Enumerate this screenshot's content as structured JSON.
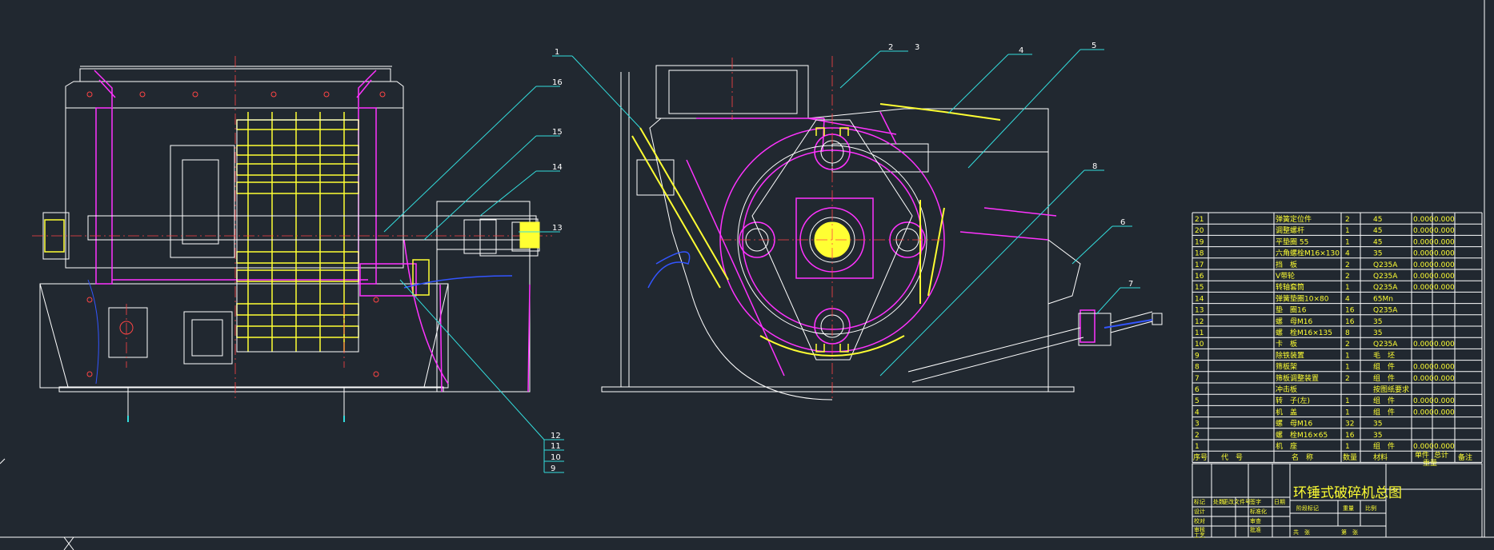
{
  "drawing": {
    "title": "环锤式破碎机总图",
    "colors": {
      "background": "#212830",
      "outline": "#ffffff",
      "magenta": "#ff33ff",
      "yellow": "#ffff33",
      "cyan": "#33dddd",
      "red": "#ff4444",
      "blue": "#3355ff",
      "green": "#88ff88"
    }
  },
  "callouts": {
    "left": [
      "16",
      "15",
      "14",
      "13",
      "12",
      "11",
      "10",
      "9"
    ],
    "right": [
      "1",
      "2",
      "3",
      "4",
      "5",
      "8",
      "6",
      "7"
    ]
  },
  "bom": {
    "header": [
      "序号",
      "代　号",
      "名　称",
      "数量",
      "材料",
      "单件",
      "总计",
      "备注"
    ],
    "weight_label": "重量",
    "rows": [
      {
        "no": "21",
        "name": "弹簧定位件",
        "qty": "2",
        "mat": "45",
        "w1": "0.000",
        "w2": "0.000"
      },
      {
        "no": "20",
        "name": "调整螺杆",
        "qty": "1",
        "mat": "45",
        "w1": "0.000",
        "w2": "0.000"
      },
      {
        "no": "19",
        "name": "平垫圈 55",
        "qty": "1",
        "mat": "45",
        "w1": "0.000",
        "w2": "0.000"
      },
      {
        "no": "18",
        "name": "六角螺栓M16×130",
        "qty": "4",
        "mat": "35",
        "w1": "0.000",
        "w2": "0.000"
      },
      {
        "no": "17",
        "name": "挡　板",
        "qty": "2",
        "mat": "Q235A",
        "w1": "0.000",
        "w2": "0.000"
      },
      {
        "no": "16",
        "name": "V带轮",
        "qty": "2",
        "mat": "Q235A",
        "w1": "0.000",
        "w2": "0.000"
      },
      {
        "no": "15",
        "name": "转轴套筒",
        "qty": "1",
        "mat": "Q235A",
        "w1": "0.000",
        "w2": "0.000"
      },
      {
        "no": "14",
        "name": "弹簧垫圈10×80",
        "qty": "4",
        "mat": "65Mn",
        "w1": "",
        "w2": ""
      },
      {
        "no": "13",
        "name": "垫　圈16",
        "qty": "16",
        "mat": "Q235A",
        "w1": "",
        "w2": ""
      },
      {
        "no": "12",
        "name": "螺　母M16",
        "qty": "16",
        "mat": "35",
        "w1": "",
        "w2": ""
      },
      {
        "no": "11",
        "name": "螺　栓M16×135",
        "qty": "8",
        "mat": "35",
        "w1": "",
        "w2": ""
      },
      {
        "no": "10",
        "name": "卡　板",
        "qty": "2",
        "mat": "Q235A",
        "w1": "0.000",
        "w2": "0.000"
      },
      {
        "no": "9",
        "name": "除铁装置",
        "qty": "1",
        "mat": "毛　坯",
        "w1": "",
        "w2": ""
      },
      {
        "no": "8",
        "name": "筛板架",
        "qty": "1",
        "mat": "组　件",
        "w1": "0.000",
        "w2": "0.000"
      },
      {
        "no": "7",
        "name": "筛板调整装置",
        "qty": "2",
        "mat": "组　件",
        "w1": "0.000",
        "w2": "0.000"
      },
      {
        "no": "6",
        "name": "冲击板",
        "qty": "",
        "mat": "按图纸要求",
        "w1": "",
        "w2": ""
      },
      {
        "no": "5",
        "name": "转　子(左)",
        "qty": "1",
        "mat": "组　件",
        "w1": "0.000",
        "w2": "0.000"
      },
      {
        "no": "4",
        "name": "机　盖",
        "qty": "1",
        "mat": "组　件",
        "w1": "0.000",
        "w2": "0.000"
      },
      {
        "no": "3",
        "name": "螺　母M16",
        "qty": "32",
        "mat": "35",
        "w1": "",
        "w2": ""
      },
      {
        "no": "2",
        "name": "螺　栓M16×65",
        "qty": "16",
        "mat": "35",
        "w1": "",
        "w2": ""
      },
      {
        "no": "1",
        "name": "机　座",
        "qty": "1",
        "mat": "组　件",
        "w1": "0.000",
        "w2": "0.000"
      }
    ]
  },
  "title_block": {
    "left_labels": [
      "标记",
      "处数",
      "更改文件号",
      "签字",
      "日期"
    ],
    "role_labels": [
      "设计",
      "校对",
      "审核",
      "工艺"
    ],
    "role_labels2": [
      "标准化",
      "审查",
      "批准"
    ],
    "stage_label": "阶段标记",
    "weight_label": "重量",
    "scale_label": "比例",
    "sheet_total": "共　张",
    "sheet_num": "第　张"
  }
}
